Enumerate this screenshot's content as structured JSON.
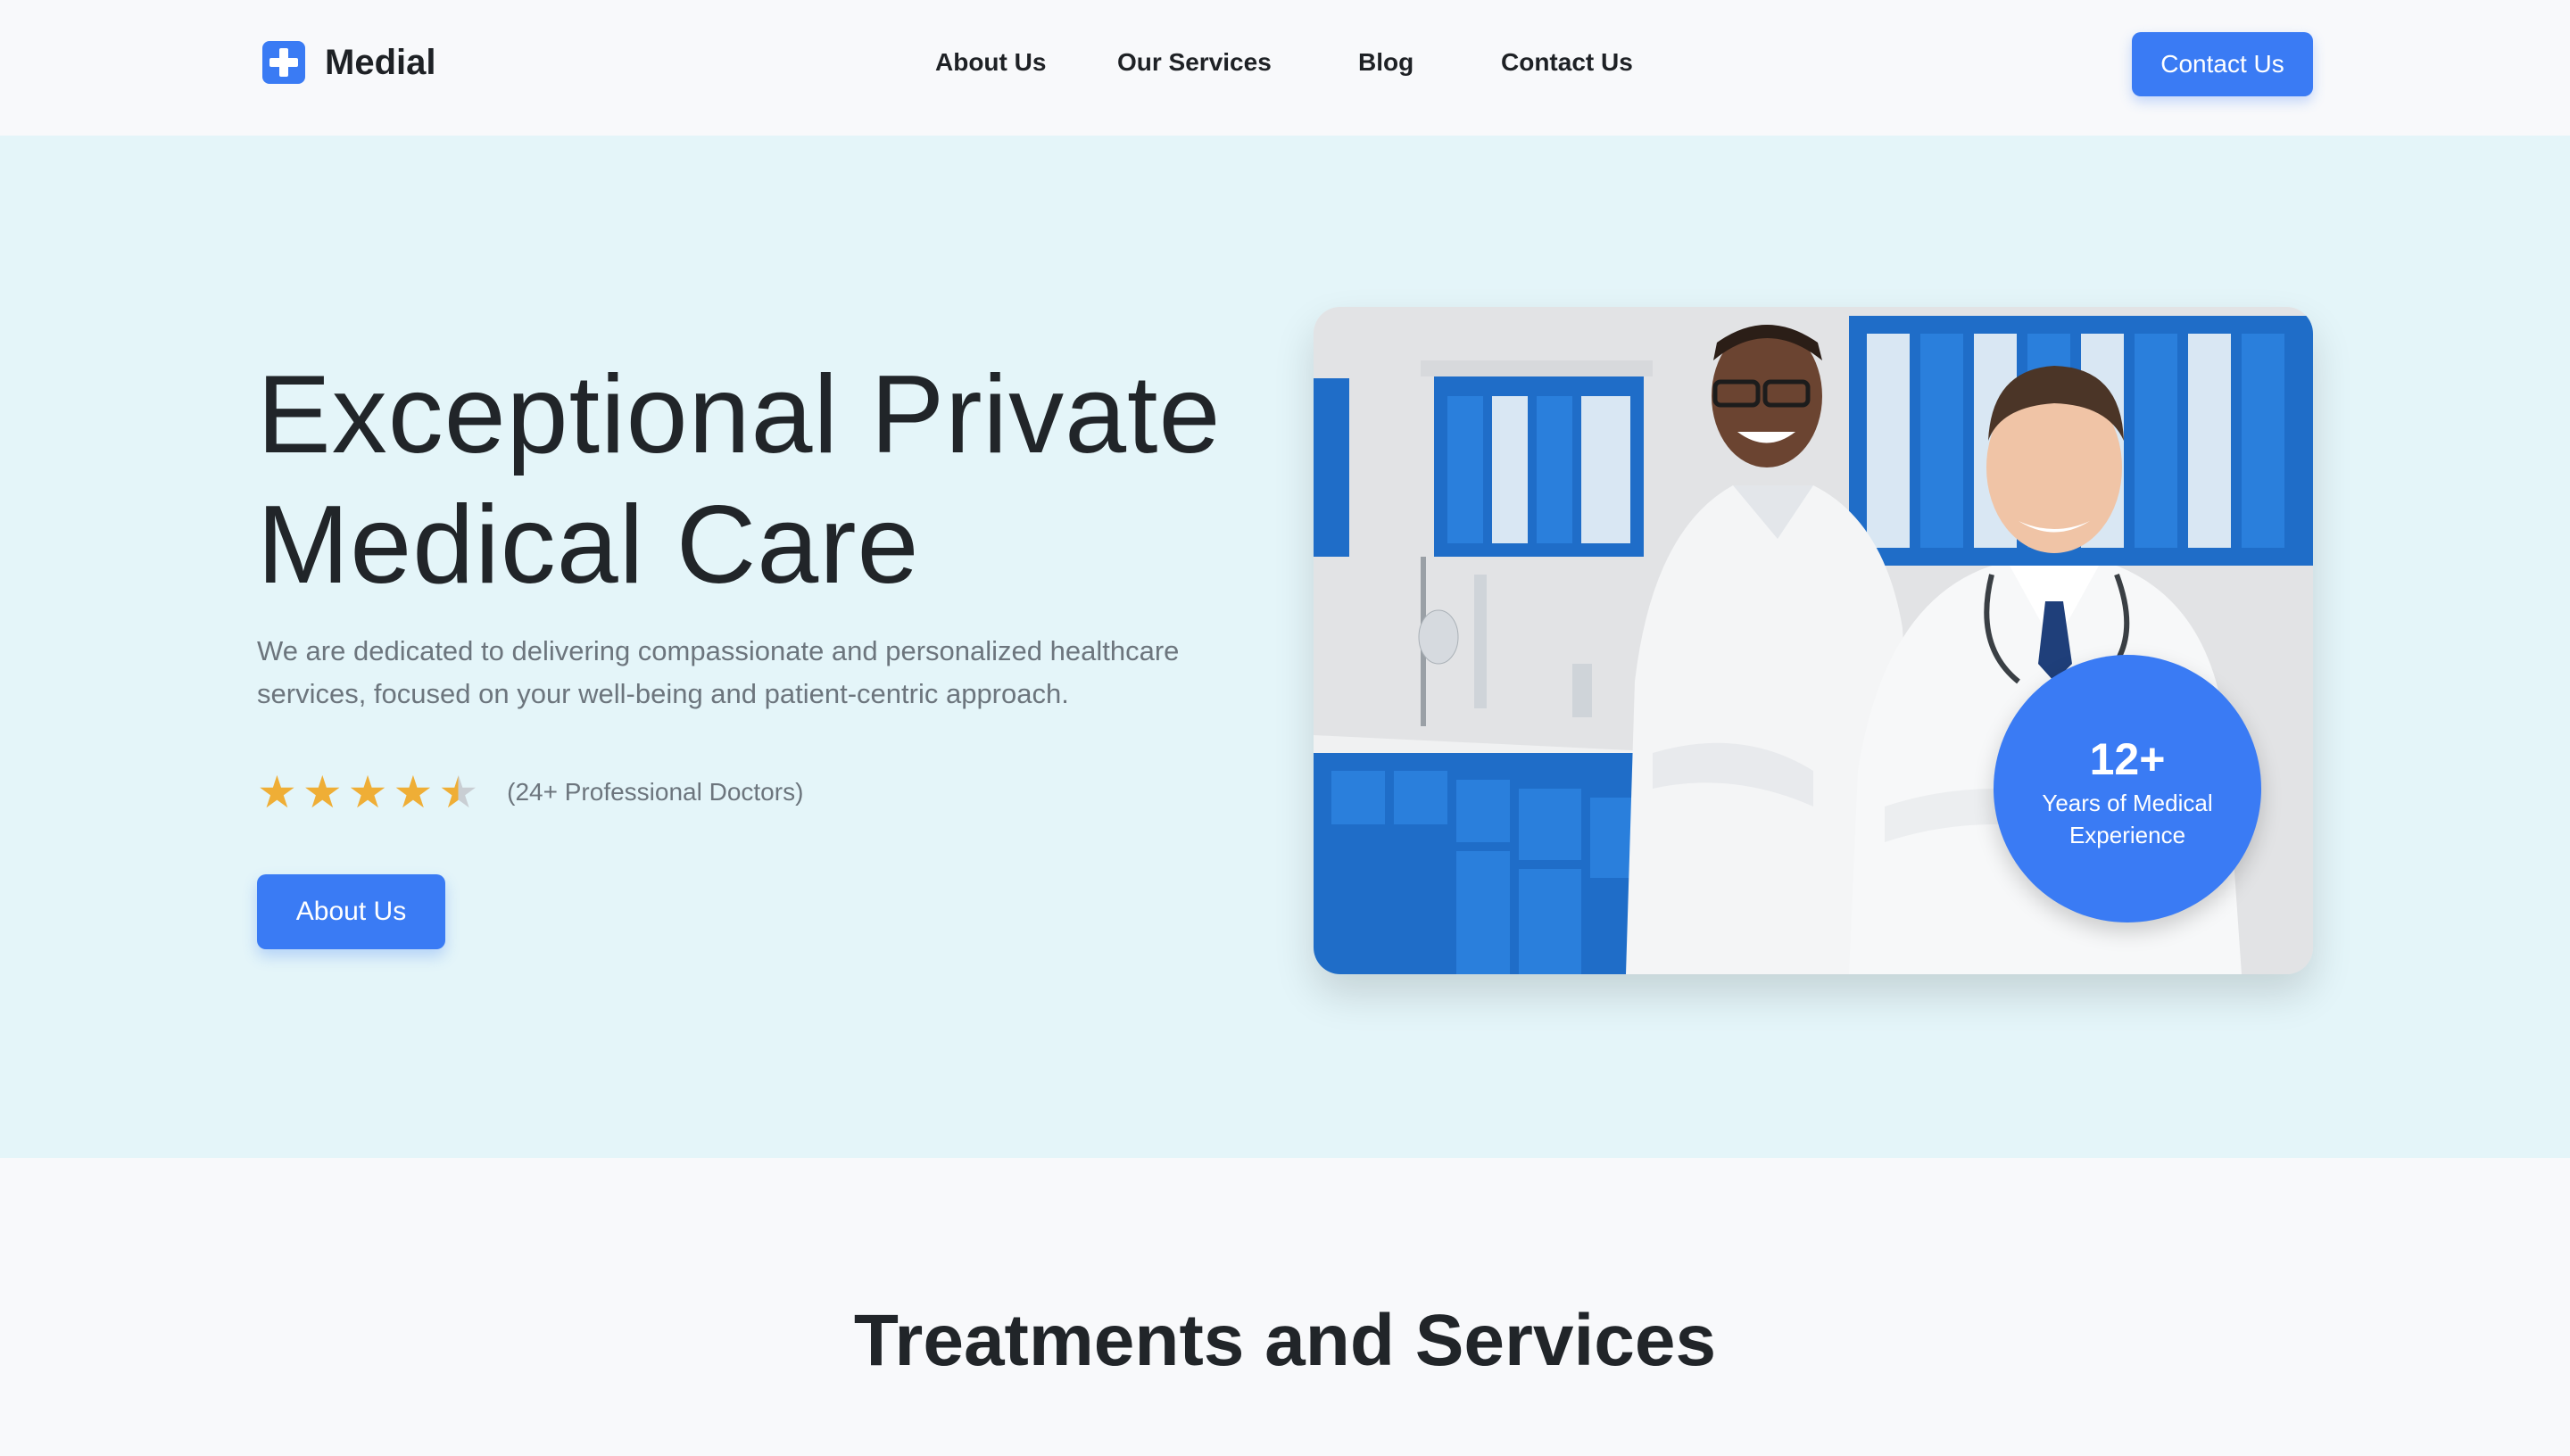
{
  "header": {
    "brand": "Medial",
    "nav": [
      "About Us",
      "Our Services",
      "Blog",
      "Contact Us"
    ],
    "cta": "Contact Us"
  },
  "hero": {
    "title_line1": "Exceptional Private",
    "title_line2": "Medical Care",
    "description": "We are dedicated to delivering compassionate and personalized healthcare services, focused on your well-being and patient-centric approach.",
    "rating_stars": 4.5,
    "rating_text": "(24+ Professional Doctors)",
    "button": "About Us",
    "badge_number": "12+",
    "badge_label": "Years of Medical Experience"
  },
  "services": {
    "title": "Treatments and Services"
  },
  "colors": {
    "accent": "#3a7bf4",
    "hero_bg": "#e4f5f9",
    "star": "#efae36",
    "text": "#212529",
    "muted": "#6c757d"
  }
}
